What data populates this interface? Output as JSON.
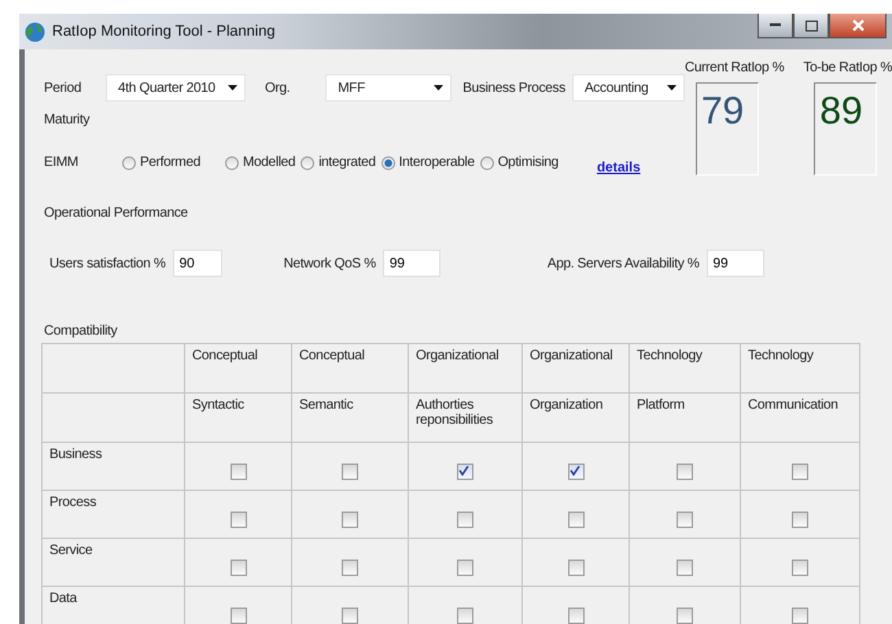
{
  "window": {
    "title": "RatIop Monitoring Tool - Planning"
  },
  "filters": [
    {
      "label": "Period",
      "value": "4th  Quarter 2010"
    },
    {
      "label": "Org.",
      "value": "MFF"
    },
    {
      "label": "Business Process",
      "value": "Accounting"
    }
  ],
  "ratios": [
    {
      "label": "Current RatIop %",
      "value": "79",
      "kind": "current"
    },
    {
      "label": "To-be RatIop %",
      "value": "89",
      "kind": "target"
    }
  ],
  "maturity": {
    "label": "Maturity",
    "eimm_label": "EIMM",
    "options": [
      {
        "label": "Performed",
        "selected": false
      },
      {
        "label": "Modelled",
        "selected": false
      },
      {
        "label": "integrated",
        "selected": false
      },
      {
        "label": "Interoperable",
        "selected": true
      },
      {
        "label": "Optimising",
        "selected": false
      }
    ],
    "link": "details"
  },
  "operational": {
    "label": "Operational Performance",
    "fields": [
      {
        "label": "Users satisfaction %",
        "value": "90"
      },
      {
        "label": "Network QoS %",
        "value": "99"
      },
      {
        "label": "App. Servers Availability %",
        "value": "99"
      }
    ]
  },
  "compatibility": {
    "label": "Compatibility",
    "columns": [
      {
        "group": "Conceptual",
        "name": "Syntactic"
      },
      {
        "group": "Conceptual",
        "name": "Semantic"
      },
      {
        "group": "Organizational",
        "name": "Authorties reponsibilities"
      },
      {
        "group": "Organizational",
        "name": "Organization"
      },
      {
        "group": "Technology",
        "name": "Platform"
      },
      {
        "group": "Technology",
        "name": "Communication"
      }
    ],
    "rows": [
      {
        "name": "Business",
        "checked": [
          false,
          false,
          true,
          true,
          false,
          false
        ]
      },
      {
        "name": "Process",
        "checked": [
          false,
          false,
          false,
          false,
          false,
          false
        ]
      },
      {
        "name": "Service",
        "checked": [
          false,
          false,
          false,
          false,
          false,
          false
        ]
      },
      {
        "name": "Data",
        "checked": [
          false,
          false,
          false,
          false,
          false,
          false
        ]
      }
    ]
  }
}
